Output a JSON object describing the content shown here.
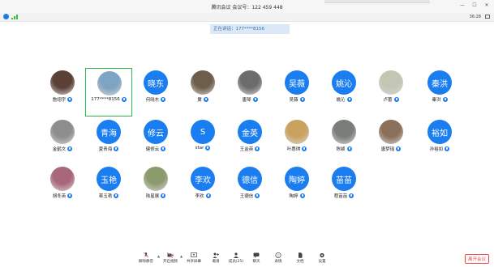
{
  "titlebar": {
    "title": "腾讯会议 会议号：122 459 448",
    "minimize_glyph": "—",
    "maximize_glyph": "☐",
    "close_glyph": "✕"
  },
  "infobar": {
    "time": "36:28"
  },
  "speaking": "正在讲话：177****8156",
  "participants": [
    {
      "name": "詹翊宇",
      "text": "",
      "type": "photo",
      "color": "#5a4035"
    },
    {
      "name": "177****8156",
      "text": "",
      "type": "photo",
      "color": "#7fa3c2"
    },
    {
      "name": "何晓东",
      "text": "晓东",
      "type": "blue"
    },
    {
      "name": "翼",
      "text": "",
      "type": "photo",
      "color": "#6e5d4a"
    },
    {
      "name": "唐琴",
      "text": "",
      "type": "photo",
      "color": "#6c6c6c"
    },
    {
      "name": "吴薇",
      "text": "吴薇",
      "type": "blue"
    },
    {
      "name": "姚沁",
      "text": "姚沁",
      "type": "blue"
    },
    {
      "name": "卢蕾",
      "text": "",
      "type": "photo",
      "color": "#c3c6b2"
    },
    {
      "name": "秦洪",
      "text": "秦洪",
      "type": "blue"
    },
    {
      "name": "金鹤文",
      "text": "",
      "type": "photo",
      "color": "#8d8d8d"
    },
    {
      "name": "夏青海",
      "text": "青海",
      "type": "blue"
    },
    {
      "name": "健修云",
      "text": "修云",
      "type": "blue"
    },
    {
      "name": "star",
      "text": "S",
      "type": "blue"
    },
    {
      "name": "王金英",
      "text": "金英",
      "type": "blue"
    },
    {
      "name": "叶惠琪",
      "text": "",
      "type": "photo",
      "color": "#c9a25f"
    },
    {
      "name": "陈颖",
      "text": "",
      "type": "photo",
      "color": "#7a7e79"
    },
    {
      "name": "唐梦瑶",
      "text": "",
      "type": "photo",
      "color": "#8a6f5a"
    },
    {
      "name": "孙裕如",
      "text": "裕如",
      "type": "blue"
    },
    {
      "name": "胡冬英",
      "text": "",
      "type": "photo",
      "color": "#a9687a"
    },
    {
      "name": "蒋玉艳",
      "text": "玉艳",
      "type": "blue"
    },
    {
      "name": "陆星展",
      "text": "",
      "type": "photo",
      "color": "#8c9b6e"
    },
    {
      "name": "李欢",
      "text": "李欢",
      "type": "blue"
    },
    {
      "name": "王德信",
      "text": "德信",
      "type": "blue"
    },
    {
      "name": "陶婷",
      "text": "陶婷",
      "type": "blue"
    },
    {
      "name": "程苗苗",
      "text": "苗苗",
      "type": "blue"
    }
  ],
  "toolbar": {
    "unmute": "解除静音",
    "video": "开启视频",
    "share": "共享屏幕",
    "invite": "邀请",
    "members": "成员(25)",
    "chat": "聊天",
    "reactions": "表情",
    "docs": "文档",
    "settings": "设置",
    "leave": "离开会议"
  },
  "colors": {
    "accent": "#1a7ef0",
    "active_border": "#2db84d",
    "leave": "#e94b4b"
  }
}
